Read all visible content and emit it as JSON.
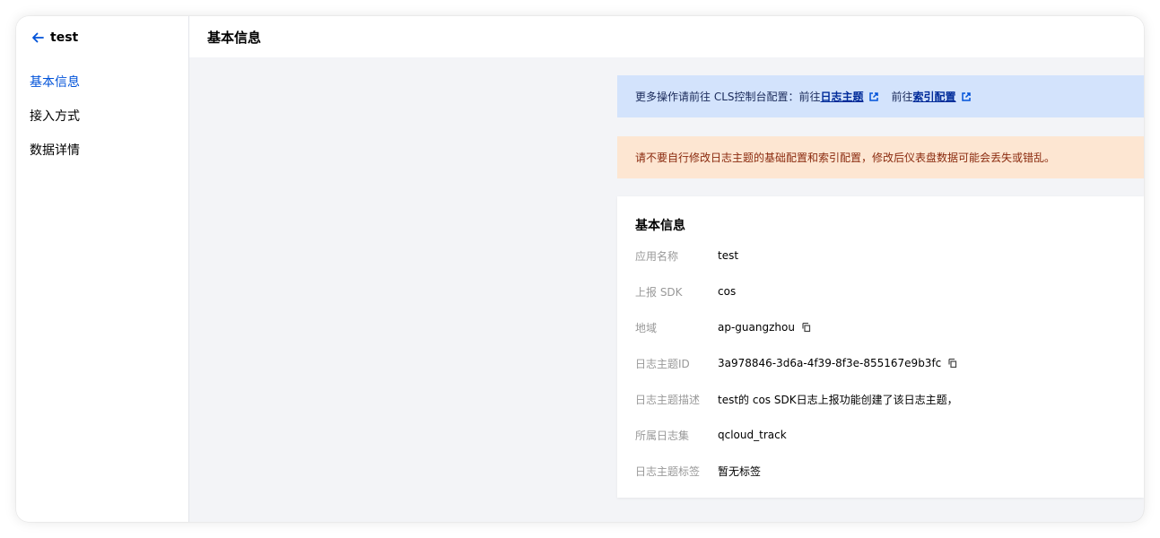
{
  "sidebar": {
    "back_icon": "arrow-left-icon",
    "title": "test",
    "items": [
      {
        "label": "基本信息",
        "active": true
      },
      {
        "label": "接入方式",
        "active": false
      },
      {
        "label": "数据详情",
        "active": false
      }
    ]
  },
  "header": {
    "title": "基本信息"
  },
  "info_alert": {
    "text": "更多操作请前往 CLS控制台配置：前往",
    "link1": "日志主题",
    "text2": "前往",
    "link2": "索引配置",
    "icon": "external-link-icon"
  },
  "warning_alert": {
    "text": "请不要自行修改日志主题的基础配置和索引配置，修改后仪表盘数据可能会丢失或错乱。"
  },
  "card": {
    "title": "基本信息",
    "rows": [
      {
        "label": "应用名称",
        "value": "test"
      },
      {
        "label": "上报 SDK",
        "value": "cos"
      },
      {
        "label": "地域",
        "value": "ap-guangzhou",
        "copy": true
      },
      {
        "label": "日志主题ID",
        "value": "3a978846-3d6a-4f39-8f3e-855167e9b3fc",
        "copy": true
      },
      {
        "label": "日志主题描述",
        "value": "test的 cos SDK日志上报功能创建了该日志主题，"
      },
      {
        "label": "所属日志集",
        "value": "qcloud_track"
      },
      {
        "label": "日志主题标签",
        "value": "暂无标签"
      }
    ]
  },
  "colors": {
    "accent": "#0052d9",
    "info_bg": "#d3e3fc",
    "warning_bg": "#fde6d2",
    "warning_text": "#8a2a0e"
  }
}
